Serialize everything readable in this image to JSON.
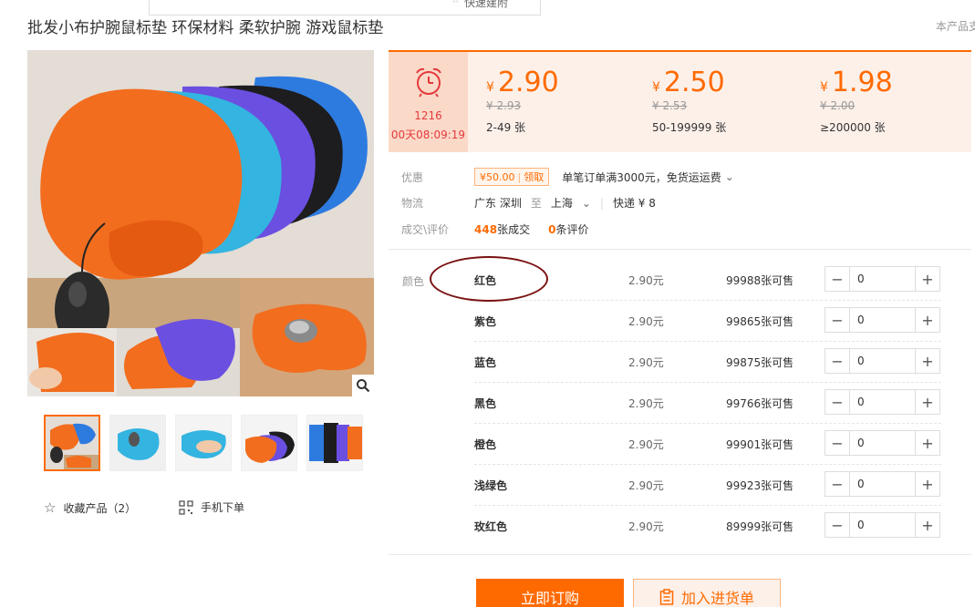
{
  "popup": {
    "text": "快速建附"
  },
  "product": {
    "title": "批发小布护腕鼠标垫 环保材料 柔软护腕 游戏鼠标垫",
    "right_note": "本产品支"
  },
  "timer": {
    "line1": "1216",
    "line2": "00天08:09:19"
  },
  "tiers": [
    {
      "currency": "¥",
      "price": "2.90",
      "old": "¥ 2.93",
      "range": "2-49 张"
    },
    {
      "currency": "¥",
      "price": "2.50",
      "old": "¥ 2.53",
      "range": "50-199999 张"
    },
    {
      "currency": "¥",
      "price": "1.98",
      "old": "¥ 2.00",
      "range": "≥200000 张"
    }
  ],
  "promo": {
    "label": "优惠",
    "coupon_amount": "¥50.00",
    "coupon_action": "领取",
    "shipping_note": "单笔订单满3000元，免货运运费"
  },
  "logistics": {
    "label": "物流",
    "from": "广东 深圳",
    "to_word": "至",
    "to": "上海",
    "express": "快递 ¥ 8"
  },
  "deals": {
    "label": "成交\\评价",
    "sold_count": "448",
    "sold_suffix": "张成交",
    "review_count": "0",
    "review_suffix": "条评价"
  },
  "sku": {
    "label": "颜色",
    "rows": [
      {
        "name": "红色",
        "price": "2.90元",
        "stock": "99988张可售",
        "qty": "0"
      },
      {
        "name": "紫色",
        "price": "2.90元",
        "stock": "99865张可售",
        "qty": "0"
      },
      {
        "name": "蓝色",
        "price": "2.90元",
        "stock": "99875张可售",
        "qty": "0"
      },
      {
        "name": "黑色",
        "price": "2.90元",
        "stock": "99766张可售",
        "qty": "0"
      },
      {
        "name": "橙色",
        "price": "2.90元",
        "stock": "99901张可售",
        "qty": "0"
      },
      {
        "name": "浅绿色",
        "price": "2.90元",
        "stock": "99923张可售",
        "qty": "0"
      },
      {
        "name": "玫红色",
        "price": "2.90元",
        "stock": "89999张可售",
        "qty": "0"
      }
    ]
  },
  "actions": {
    "favorite": "收藏产品（2）",
    "mobile_order": "手机下单",
    "buy_now": "立即订购",
    "add_to_cart": "加入进货单"
  },
  "colors": {
    "accent": "#ff6a00",
    "price_bg": "#fdf0e9",
    "timer_bg": "#fbd9c8",
    "annotation": "#7a1212"
  }
}
